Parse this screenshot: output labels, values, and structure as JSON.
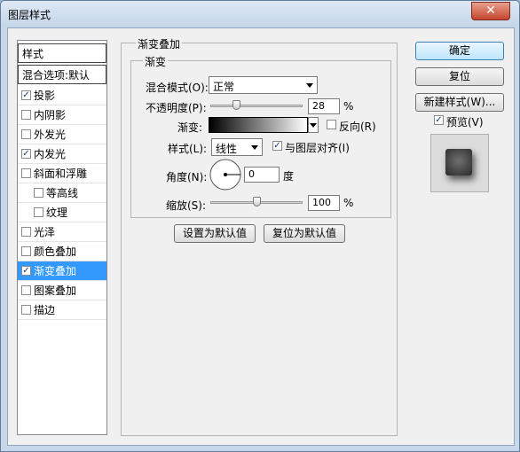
{
  "window": {
    "title": "图层样式",
    "close_glyph": "✕"
  },
  "left_panel": {
    "header": "样式",
    "blend_options": "混合选项:默认",
    "items": [
      {
        "label": "投影",
        "checked": true
      },
      {
        "label": "内阴影",
        "checked": false
      },
      {
        "label": "外发光",
        "checked": false
      },
      {
        "label": "内发光",
        "checked": true
      },
      {
        "label": "斜面和浮雕",
        "checked": false
      },
      {
        "label": "等高线",
        "checked": false
      },
      {
        "label": "纹理",
        "checked": false
      },
      {
        "label": "光泽",
        "checked": false
      },
      {
        "label": "颜色叠加",
        "checked": false
      },
      {
        "label": "渐变叠加",
        "checked": true,
        "selected": true
      },
      {
        "label": "图案叠加",
        "checked": false
      },
      {
        "label": "描边",
        "checked": false
      }
    ]
  },
  "main": {
    "outer_title": "渐变叠加",
    "inner_title": "渐变",
    "blend_mode_label": "混合模式(O):",
    "blend_mode_value": "正常",
    "opacity_label": "不透明度(P):",
    "opacity_value": "28",
    "opacity_fraction": 0.28,
    "percent_sign": "%",
    "gradient_label": "渐变:",
    "reverse_label": "反向(R)",
    "reverse_checked": false,
    "style_label": "样式(L):",
    "style_value": "线性",
    "align_label": "与图层对齐(I)",
    "align_checked": true,
    "angle_label": "角度(N):",
    "angle_value": "0",
    "degree_label": "度",
    "scale_label": "缩放(S):",
    "scale_value": "100",
    "scale_fraction": 0.5,
    "set_default_label": "设置为默认值",
    "reset_default_label": "复位为默认值"
  },
  "right": {
    "ok_label": "确定",
    "reset_label": "复位",
    "new_style_label": "新建样式(W)...",
    "preview_label": "预览(V)",
    "preview_checked": true
  },
  "check_glyph": "✓"
}
